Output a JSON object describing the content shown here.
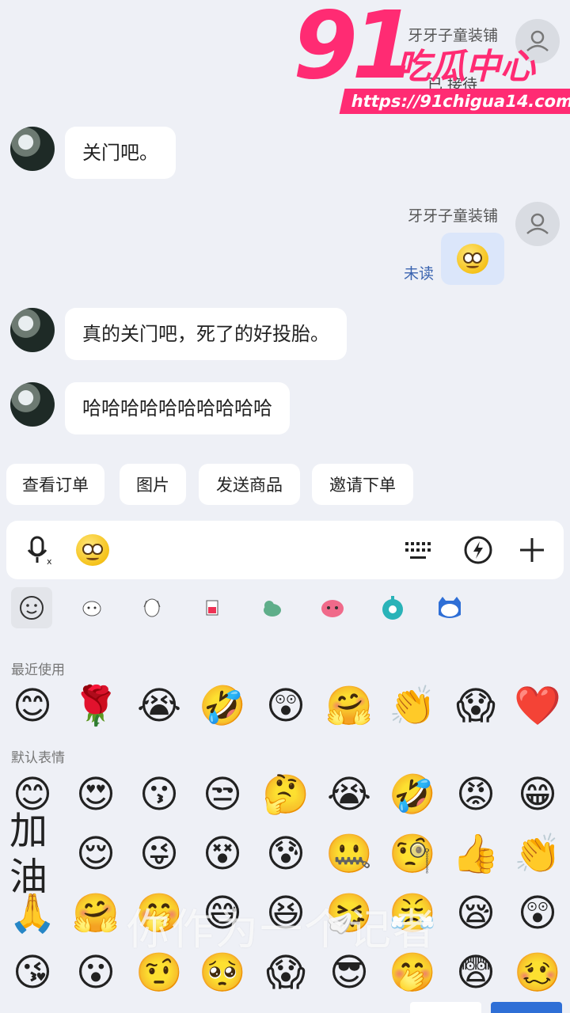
{
  "chat": {
    "shop_name": "牙牙子童装铺",
    "top_partial_text": "已 接待",
    "messages": [
      {
        "side": "left",
        "text": "关门吧。"
      },
      {
        "side": "right",
        "status": "未读",
        "content": "emoji"
      },
      {
        "side": "left",
        "text": "真的关门吧，死了的好投胎。"
      },
      {
        "side": "left",
        "text": "哈哈哈哈哈哈哈哈哈哈"
      }
    ]
  },
  "quick_actions": [
    "查看订单",
    "图片",
    "发送商品",
    "邀请下单"
  ],
  "input_bar": {
    "icons": [
      "voice-input-icon",
      "emoji-icon",
      "keyboard-icon",
      "quick-reply-icon",
      "plus-icon"
    ]
  },
  "emoji_panel": {
    "packs": [
      "smiley",
      "pack-1",
      "pack-2",
      "pack-3",
      "pack-4",
      "pack-5",
      "pack-6",
      "pack-7"
    ],
    "recent_label": "最近使用",
    "default_label": "默认表情",
    "recent": [
      "😊",
      "🌹",
      "😭",
      "🤣",
      "😲",
      "🤗",
      "👏",
      "😱",
      "❤️"
    ],
    "default_rows": [
      [
        "😊",
        "😍",
        "😗",
        "😒",
        "🤔",
        "😭",
        "🤣",
        "😡",
        "😁"
      ],
      [
        "加油",
        "😌",
        "😜",
        "😵",
        "😰",
        "🤐",
        "🧐",
        "👍",
        "👏"
      ],
      [
        "🙏",
        "🤗",
        "🤭",
        "😅",
        "😆",
        "🤧",
        "😤",
        "😪",
        "😲"
      ],
      [
        "😘",
        "😮",
        "🤨",
        "🥺",
        "😱",
        "😎",
        "🤭",
        "😨",
        "🥴"
      ]
    ]
  },
  "overlay_text": "你作为一个记者",
  "watermark": {
    "number": "91",
    "name": "吃瓜中心",
    "url": "https://91chigua14.com"
  }
}
